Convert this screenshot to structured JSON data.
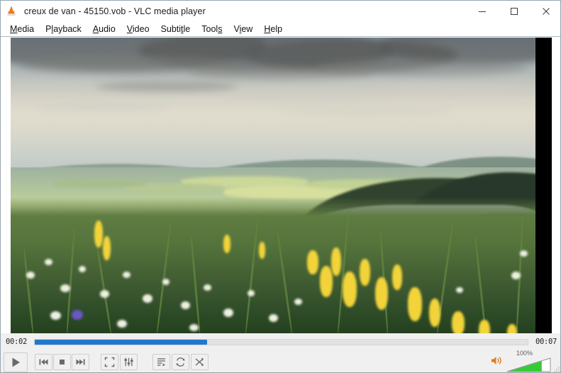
{
  "window": {
    "title": "creux de van - 45150.vob - VLC media player",
    "app_icon": "vlc-cone-icon",
    "controls": {
      "minimize": "minimize-icon",
      "maximize": "maximize-icon",
      "close": "close-icon"
    }
  },
  "menubar": {
    "items": [
      {
        "label": "Media",
        "pre": "",
        "mnemonic": "M",
        "post": "edia"
      },
      {
        "label": "Playback",
        "pre": "P",
        "mnemonic": "l",
        "post": "ayback"
      },
      {
        "label": "Audio",
        "pre": "",
        "mnemonic": "A",
        "post": "udio"
      },
      {
        "label": "Video",
        "pre": "",
        "mnemonic": "V",
        "post": "ideo"
      },
      {
        "label": "Subtitle",
        "pre": "Subti",
        "mnemonic": "t",
        "post": "le"
      },
      {
        "label": "Tools",
        "pre": "Tool",
        "mnemonic": "s",
        "post": ""
      },
      {
        "label": "View",
        "pre": "V",
        "mnemonic": "i",
        "post": "ew"
      },
      {
        "label": "Help",
        "pre": "",
        "mnemonic": "H",
        "post": "elp"
      }
    ]
  },
  "video": {
    "scene_description": "Creux du Van limestone cliff landscape at golden hour with wildflower meadow foreground, green valley and cloudy sky",
    "letterboxed": true
  },
  "playback": {
    "elapsed": "00:02",
    "total": "00:07",
    "progress_percent": 35,
    "progress_fill_color": "#2277cc",
    "track_color": "#e2e2e2"
  },
  "controls": {
    "play": "play-icon",
    "previous": "previous-track-icon",
    "stop": "stop-icon",
    "next": "next-track-icon",
    "fullscreen": "fullscreen-icon",
    "equalizer": "equalizer-icon",
    "playlist": "playlist-icon",
    "loop": "loop-icon",
    "shuffle": "shuffle-icon"
  },
  "volume": {
    "level_label": "100%",
    "level_percent": 100,
    "speaker_icon": "speaker-icon",
    "fill_color": "#33cc33"
  }
}
